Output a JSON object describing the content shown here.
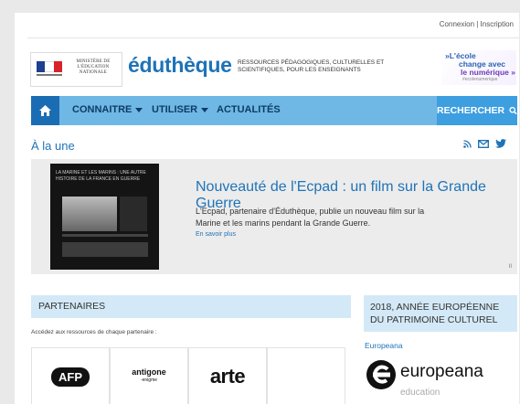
{
  "header": {
    "top_links": "Connexion | Inscription",
    "ministry": "MINISTÈRE DE L'ÉDUCATION NATIONALE",
    "brand": "éduthèque",
    "tagline": "RESSOURCES PÉDAGOGIQUES, CULTURELLES ET SCIENTIFIQUES, POUR LES ENSEIGNANTS",
    "badge": {
      "line1": "»L'école",
      "line2": "change avec",
      "line3": "le numérique »",
      "line4": "#ecolenumerique"
    }
  },
  "nav": {
    "items": [
      {
        "label": "CONNAITRE"
      },
      {
        "label": "UTILISER"
      },
      {
        "label": "ACTUALITÉS"
      }
    ],
    "search_label": "RECHERCHER"
  },
  "section": {
    "title": "À la une",
    "icons": [
      "rss-icon",
      "mail-icon",
      "twitter-icon"
    ]
  },
  "feature": {
    "thumb_title": "LA MARINE ET LES MARINS : UNE AUTRE HISTOIRE DE LA FRANCE EN GUERRE",
    "title": "Nouveauté de l'Ecpad : un film sur la Grande Guerre",
    "description": "L'Ecpad, partenaire d'Éduthèque, publie un nouveau film sur la Marine et les marins pendant la Grande Guerre.",
    "more": "En savoir plus",
    "pager": "II"
  },
  "partners": {
    "title": "PARTENAIRES",
    "subtitle": "Accédez aux ressources de chaque partenaire :",
    "logos": [
      {
        "text": "AFP"
      },
      {
        "text": "antigone",
        "sub": "-enigme"
      },
      {
        "text": "arte"
      }
    ]
  },
  "eu": {
    "title": "2018, ANNÉE EUROPÉENNE DU PATRIMOINE CULTUREL",
    "link": "Europeana",
    "logo_word": "europeana",
    "logo_sub": "education"
  },
  "colors": {
    "accent": "#1f73b7",
    "nav": "#6fb8e6",
    "nav_dark": "#1b6db3",
    "panel": "#d4e9f7"
  }
}
